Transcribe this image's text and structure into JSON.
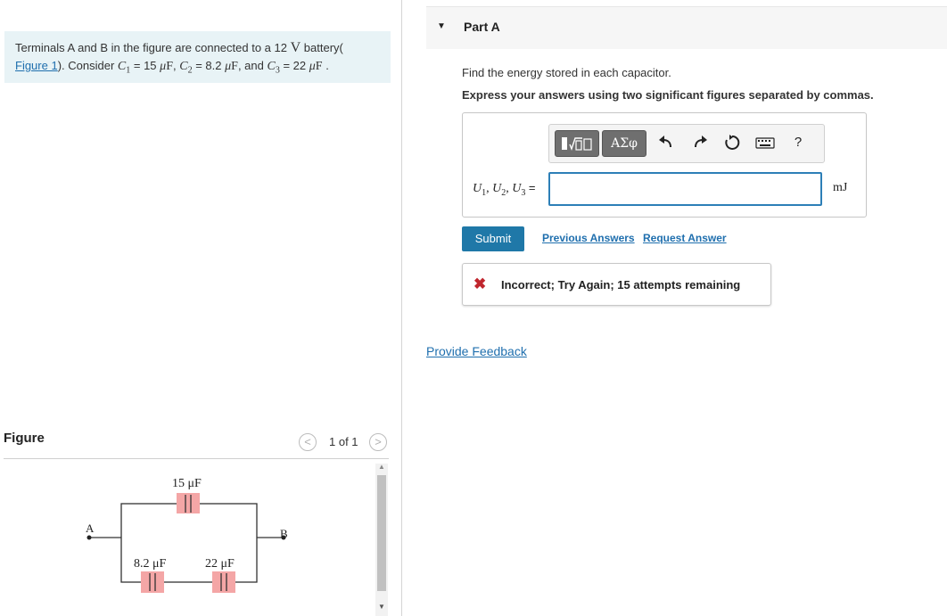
{
  "problem": {
    "text_before": "Terminals A and B in the figure are connected to a 12",
    "volt_unit": "V",
    "text_after_volt": "battery(",
    "figure_link": "Figure 1",
    "text_consider": "). Consider",
    "c1_label": "C",
    "c1_sub": "1",
    "c1_value": "= 15",
    "c2_label": "C",
    "c2_sub": "2",
    "c2_value": "= 8.2",
    "c3_label": "C",
    "c3_sub": "3",
    "c3_value": "= 22",
    "unit_mu": "μ",
    "unit_f": "F",
    "sep": ",",
    "and": ", and",
    "end": "."
  },
  "figure": {
    "label": "Figure",
    "prev_icon": "chevron-left",
    "next_icon": "chevron-right",
    "prev_glyph": "<",
    "next_glyph": ">",
    "count": "1 of 1",
    "circuit": {
      "top_cap_label": "15 μF",
      "bottom_left_cap_label": "8.2 μF",
      "bottom_right_cap_label": "22 μF",
      "terminal_a": "A",
      "terminal_b": "B",
      "capacitor_highlight": "#f4a6a6"
    }
  },
  "part": {
    "arrow": "▼",
    "title": "Part A",
    "question": "Find the energy stored in each capacitor.",
    "instruction": "Express your answers using two significant figures separated by commas."
  },
  "toolbar": {
    "template_icon": "templates-icon",
    "greek_label": "ΑΣφ",
    "undo_icon": "undo-icon",
    "redo_icon": "redo-icon",
    "reset_icon": "reset-icon",
    "keyboard_icon": "keyboard-icon",
    "help_label": "?"
  },
  "answer": {
    "label_u": "U",
    "sub1": "1",
    "sub2": "2",
    "sub3": "3",
    "comma": ",",
    "equals": "=",
    "value": "",
    "unit": "mJ"
  },
  "actions": {
    "submit": "Submit",
    "previous_answers": "Previous Answers",
    "request_answer": "Request Answer"
  },
  "feedback": {
    "icon": "x-icon",
    "glyph": "✖",
    "text": "Incorrect; Try Again; 15 attempts remaining",
    "color": "#c0262d"
  },
  "provide_feedback": "Provide Feedback",
  "colors": {
    "accent": "#1f78a8",
    "link": "#1f6fae",
    "problem_bg": "#e8f3f6"
  }
}
